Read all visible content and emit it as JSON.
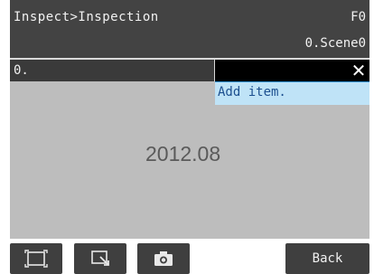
{
  "header": {
    "breadcrumb": "Inspect>Inspection",
    "mode": "F0",
    "scene": "0.Scene0"
  },
  "bar": {
    "label": "0."
  },
  "dropdown": {
    "item": "Add item."
  },
  "view": {
    "version": "2012.08"
  },
  "toolbar": {
    "icons": [
      "fullscreen-icon",
      "zoom-select-icon",
      "camera-icon"
    ],
    "back_label": "Back"
  }
}
